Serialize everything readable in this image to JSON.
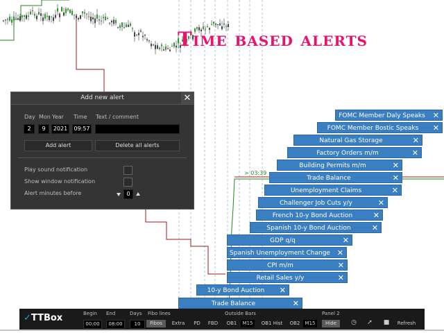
{
  "headline": "Time based alerts",
  "chart": {
    "time_label": "> 03:39"
  },
  "dialog": {
    "title": "Add new alert",
    "close_icon": "✕",
    "headers": {
      "day": "Day",
      "mon": "Mon",
      "year": "Year",
      "time": "Time",
      "text": "Text / comment"
    },
    "values": {
      "day": "2",
      "mon": "9",
      "year": "2021",
      "time": "09:57",
      "text": ""
    },
    "add_label": "Add alert",
    "delete_label": "Delete all alerts",
    "play_sound": "Play sound notification",
    "show_window": "Show window notification",
    "minutes_before": "Alert minutes before",
    "minutes_value": "0"
  },
  "alerts": [
    {
      "label": "FOMC Member Daly Speaks"
    },
    {
      "label": "FOMC Member Bostic Speaks"
    },
    {
      "label": "Natural Gas Storage"
    },
    {
      "label": "Factory Orders m/m"
    },
    {
      "label": "Building Permits m/m"
    },
    {
      "label": "Trade Balance"
    },
    {
      "label": "Unemployment Claims"
    },
    {
      "label": "Challenger Job Cuts y/y"
    },
    {
      "label": "French 10-y Bond Auction"
    },
    {
      "label": "Spanish 10-y Bond Auction"
    },
    {
      "label": "GDP q/q"
    },
    {
      "label": "Spanish Unemployment Change"
    },
    {
      "label": "CPI m/m"
    },
    {
      "label": "Retail Sales y/y"
    },
    {
      "label": "10-y Bond Auction"
    },
    {
      "label": "Trade Balance"
    }
  ],
  "toolbar": {
    "logo_text": "TTBox",
    "begin_label": "Begin",
    "begin": "00:00",
    "end_label": "End",
    "end": "08:00",
    "days_label": "Days",
    "days": "10",
    "fibo_label": "Fibo lines",
    "fibos": "Fibos",
    "extra": "Extra",
    "pd": "PD",
    "fbd": "FBD",
    "outside_label": "Outside Bars",
    "ob1": "OB1",
    "m15a": "M15",
    "ob1hist": "OB1 Hist",
    "ob2": "OB2",
    "m15b": "M15",
    "panel_label": "Panel 2",
    "hide": "Hide",
    "refresh": "Refresh"
  }
}
